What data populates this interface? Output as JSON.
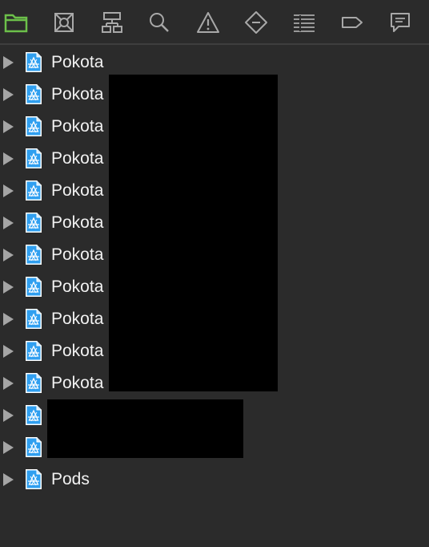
{
  "toolbar": {
    "buttons": [
      {
        "name": "project-navigator-icon",
        "active": true
      },
      {
        "name": "source-control-icon",
        "active": false
      },
      {
        "name": "symbol-navigator-icon",
        "active": false
      },
      {
        "name": "find-navigator-icon",
        "active": false
      },
      {
        "name": "issue-navigator-icon",
        "active": false
      },
      {
        "name": "test-navigator-icon",
        "active": false
      },
      {
        "name": "debug-navigator-icon",
        "active": false
      },
      {
        "name": "breakpoint-navigator-icon",
        "active": false
      },
      {
        "name": "report-navigator-icon",
        "active": false
      }
    ]
  },
  "tree": {
    "items": [
      {
        "label": "Pokota",
        "expanded": false
      },
      {
        "label": "Pokota",
        "expanded": false
      },
      {
        "label": "Pokota",
        "expanded": false
      },
      {
        "label": "Pokota",
        "expanded": false
      },
      {
        "label": "Pokota",
        "expanded": false
      },
      {
        "label": "Pokota",
        "expanded": false
      },
      {
        "label": "Pokota",
        "expanded": false
      },
      {
        "label": "Pokota",
        "expanded": false
      },
      {
        "label": "Pokota",
        "expanded": false
      },
      {
        "label": "Pokota",
        "expanded": false
      },
      {
        "label": "Pokota",
        "expanded": false
      },
      {
        "label": "",
        "expanded": false
      },
      {
        "label": "",
        "expanded": false
      },
      {
        "label": "Pods",
        "expanded": false
      }
    ]
  },
  "colors": {
    "background": "#2b2b2b",
    "active_icon": "#6cc04a",
    "inactive_icon": "#a8a8a8",
    "label_text": "#f2f2f2",
    "project_icon_blue": "#2f9ff0",
    "redaction": "#000000"
  }
}
